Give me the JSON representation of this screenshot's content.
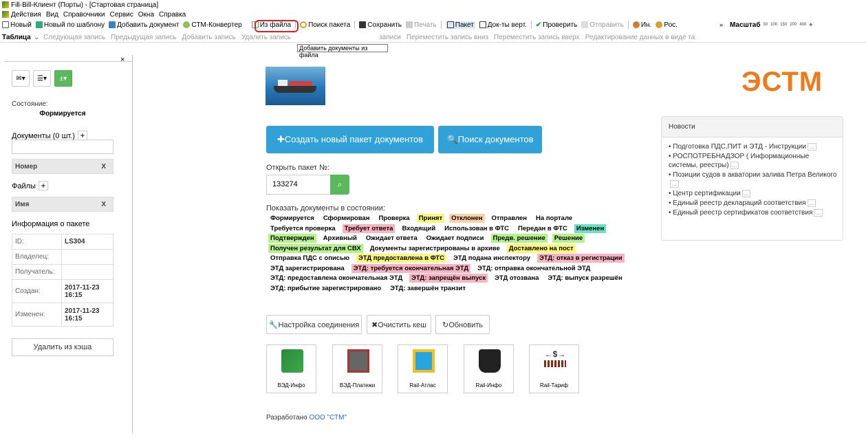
{
  "window": {
    "title": "Fill-Bill-Клиент (Порты) - [Стартовая страница]"
  },
  "menu": [
    "Действия",
    "Вид",
    "Справочники",
    "Сервис",
    "Окна",
    "Справка"
  ],
  "toolbar": {
    "new": "Новый",
    "new_template": "Новый по шаблону",
    "add_doc": "Добавить документ",
    "stm_converter": "СТМ-Конвертер",
    "from_file": "Из файла",
    "search_package": "Поиск пакета",
    "save": "Сохранить",
    "print": "Печать",
    "package": "Пакет",
    "docs_vert": "Док-ты верт.",
    "check": "Проверить",
    "send": "Отправить",
    "in": "Ин.",
    "ros": "Рос.",
    "more": "»",
    "zoom_label": "Масштаб",
    "zoom_steps": [
      "50",
      "100",
      "150",
      "200",
      "400"
    ]
  },
  "table_toolbar": {
    "label": "Таблица",
    "next": "Следующая запись",
    "prev": "Предыдущая запись",
    "add": "Добавить запись",
    "delete": "Удалить запись",
    "records": "записи",
    "move_down": "Переместить запись вниз",
    "move_up": "Переместить запись вверх",
    "edit_table": "Редактирование данных в виде та"
  },
  "tooltip": "Добавить документы из файла",
  "left_panel": {
    "close": "×",
    "buttons": [
      "✉▾",
      "☰▾",
      "±▾"
    ],
    "state_label": "Состояние:",
    "state_value": "Формируется",
    "docs_label": "Документы (0 шт.)",
    "docs_col": "Номер",
    "files_label": "Файлы",
    "files_col": "Имя",
    "col_clear": "X",
    "info_label": "Информация о пакете",
    "info": [
      {
        "k": "ID:",
        "v": "LS304"
      },
      {
        "k": "Владелец:",
        "v": ""
      },
      {
        "k": "Получатель:",
        "v": ""
      },
      {
        "k": "Создан:",
        "v": "2017-11-23 16:15"
      },
      {
        "k": "Изменен:",
        "v": "2017-11-23 16:15"
      }
    ],
    "delete_cache": "Удалить из кэша"
  },
  "main": {
    "logo": "ЭСТМ",
    "create_btn": "✚Создать новый пакет документов",
    "search_btn": "🔍Поиск документов",
    "open_label": "Открыть пакет №:",
    "open_value": "133274",
    "show_label": "Показать документы в состоянии:",
    "status_rows": [
      [
        [
          "Формируется",
          ""
        ],
        [
          "Сформирован",
          ""
        ],
        [
          "Проверка",
          ""
        ],
        [
          "Принят",
          "yellow"
        ],
        [
          "Отклонен",
          "orange"
        ],
        [
          "Отправлен",
          ""
        ],
        [
          "На портале",
          ""
        ]
      ],
      [
        [
          "Требуется проверка",
          ""
        ],
        [
          "Требует ответа",
          "pink"
        ],
        [
          "Входящий",
          ""
        ],
        [
          "Использован в ФТС",
          ""
        ],
        [
          "Передан в ФТС",
          ""
        ],
        [
          "Изменен",
          "teal"
        ]
      ],
      [
        [
          "Подтвержден",
          "green"
        ],
        [
          "Архивный",
          ""
        ],
        [
          "Ожидает ответа",
          ""
        ],
        [
          "Ожидает подписи",
          ""
        ],
        [
          "Предв. решение",
          "green"
        ],
        [
          "Решение",
          "green"
        ]
      ],
      [
        [
          "Получен результат для СВХ",
          "green"
        ],
        [
          "Документы зарегистрированы в архиве",
          ""
        ],
        [
          "Доставлено на пост",
          "yellow"
        ]
      ],
      [
        [
          "Отправка ПДС с описью",
          ""
        ],
        [
          "ЭТД предоставлена в ФТС",
          "yellow"
        ],
        [
          "ЭТД подана инспектору",
          ""
        ],
        [
          "ЭТД: отказ в регистрации",
          "pink"
        ]
      ],
      [
        [
          "ЭТД зарегистрирована",
          ""
        ],
        [
          "ЭТД: требуется окончательная ЭТД",
          "pink"
        ],
        [
          "ЭТД: отправка окончательной ЭТД",
          ""
        ]
      ],
      [
        [
          "ЭТД: предоставлена окончательная ЭТД",
          ""
        ],
        [
          "ЭТД: запрещён выпуск",
          "pink"
        ],
        [
          "ЭТД отозвана",
          ""
        ],
        [
          "ЭТД: выпуск разрешён",
          ""
        ]
      ],
      [
        [
          "ЭТД: прибытие зарегистрировано",
          ""
        ],
        [
          "ЭТД: завершён транзит",
          ""
        ]
      ]
    ],
    "settings_btn": "🔧Настройка соединения",
    "clear_btn": "✖Очистить кеш",
    "refresh_btn": "↻Обновить",
    "tiles": [
      "ВЭД-Инфо",
      "ВЭД-Платежи",
      "Rail-Атлас",
      "Rail-Инфо",
      "Rail-Тариф"
    ],
    "dev_prefix": "Разработано ",
    "dev_link": "ООО \"СТМ\""
  },
  "news": {
    "title": "Новости",
    "items": [
      "Подготовка ПДС,ПИТ и ЭТД - Инструкции",
      "РОСПОТРЕБНАДЗОР ( Информационные системы, реестры)",
      "Позиции судов в акватории залива Петра Великого",
      "Центр сертификации",
      "Единый реестр деклараций соответствия",
      "Единый реестр сертификатов соответствия"
    ],
    "more": "..."
  }
}
